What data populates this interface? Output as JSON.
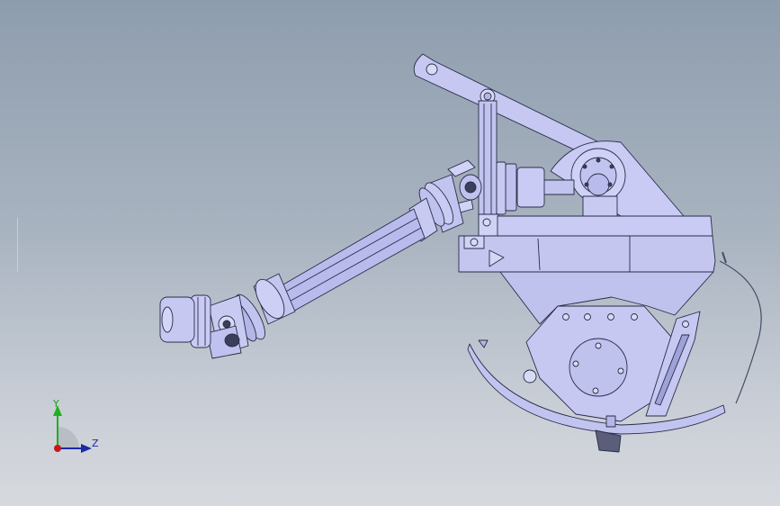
{
  "viewport": {
    "background_top": "#8e9dae",
    "background_bottom": "#d6d9de",
    "part_fill": "#c6c8f2",
    "part_stroke": "#2a2c48",
    "shaft_fill": "#b8bbec",
    "dark_fill": "#3c3f5a"
  },
  "triad": {
    "y_label": "Y",
    "z_label": "Z",
    "y_color": "#1fb01f",
    "z_color": "#1a2aa8",
    "x_color": "#c81818"
  }
}
